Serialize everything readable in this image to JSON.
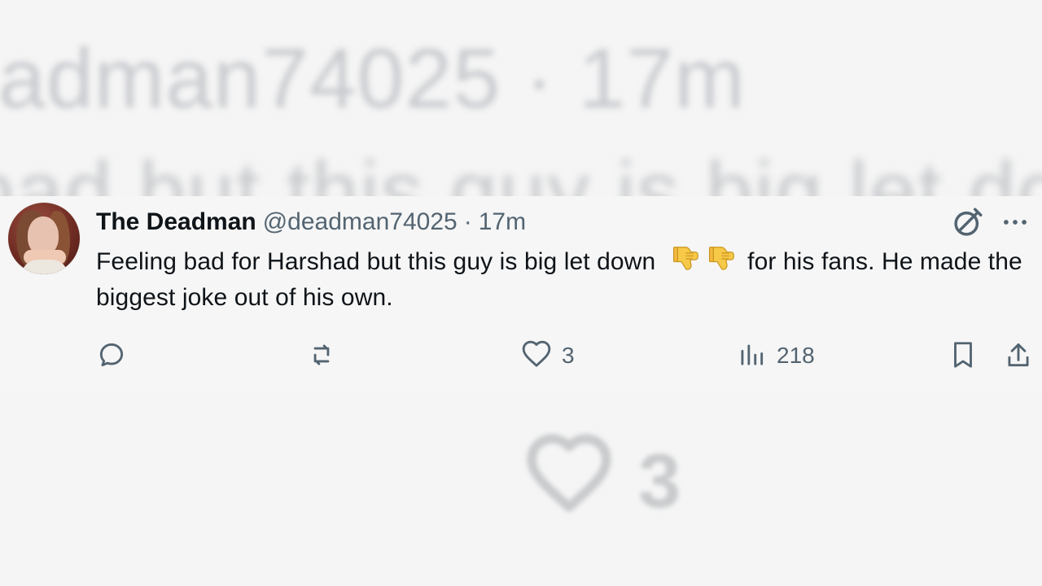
{
  "background": {
    "top_blur_text": "adman74025 · 17m",
    "mid_blur_text": "bad but this guy is big let do",
    "like_count": "3"
  },
  "tweet": {
    "display_name": "The Deadman",
    "handle": "@deadman74025",
    "separator": "·",
    "time": "17m",
    "text_before_emoji": "Feeling bad for Harshad but this guy is big let down",
    "text_after_emoji": "for his fans. He made the biggest joke out of his own.",
    "emoji_icons": [
      "thumbs-down-emoji",
      "thumbs-down-emoji"
    ]
  },
  "actions": {
    "likes": "3",
    "views": "218"
  },
  "colors": {
    "text_primary": "#0f1419",
    "text_secondary": "#536471",
    "background": "#f5f5f5"
  },
  "icons": {
    "grok": "grok-icon",
    "more": "more-options-icon",
    "reply": "reply-icon",
    "repost": "repost-icon",
    "like": "heart-icon",
    "views": "analytics-icon",
    "bookmark": "bookmark-icon",
    "share": "share-icon"
  }
}
